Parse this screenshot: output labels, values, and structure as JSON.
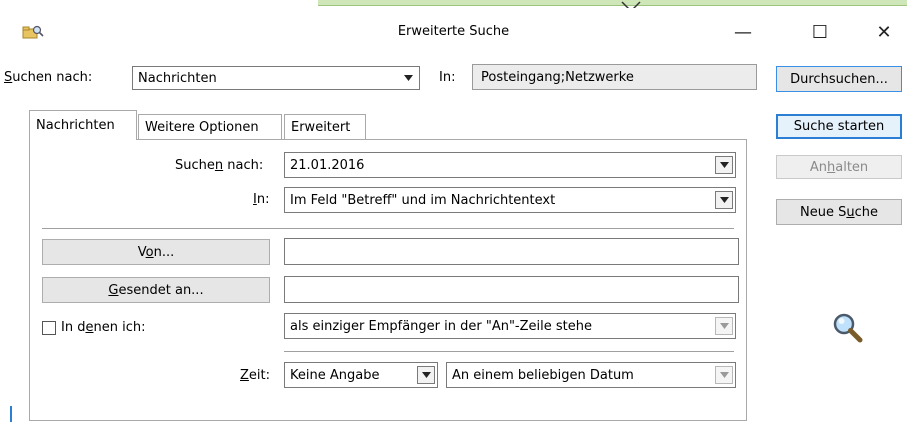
{
  "window": {
    "title": "Erweiterte Suche",
    "controls": {
      "minimize": "—",
      "maximize": "☐",
      "close": "✕"
    }
  },
  "search_row": {
    "look_for_label": "Suchen nach:",
    "look_for_value": "Nachrichten",
    "in_label": "In:",
    "in_value": "Posteingang;Netzwerke"
  },
  "buttons": {
    "browse": "Durchsuchen...",
    "find_now": "Suche starten",
    "stop": "Anhalten",
    "new_search": "Neue Suche"
  },
  "tabs": [
    {
      "label": "Nachrichten",
      "active": true
    },
    {
      "label": "Weitere Optionen",
      "active": false
    },
    {
      "label": "Erweitert",
      "active": false
    }
  ],
  "form": {
    "search_for_label": "Suchen nach:",
    "search_for_value": "21.01.2016",
    "in_label": "In:",
    "in_value": "Im Feld \"Betreff\" und im Nachrichtentext",
    "from_button": "Von...",
    "from_value": "",
    "sent_to_button": "Gesendet an...",
    "sent_to_value": "",
    "where_i_am_label": "In denen ich:",
    "where_i_am_value": "als einziger Empfänger in der \"An\"-Zeile stehe",
    "where_i_am_checked": false,
    "time_label": "Zeit:",
    "time_value": "Keine Angabe",
    "date_value": "An einem beliebigen Datum"
  },
  "icons": {
    "app": "search-folder-icon",
    "magnifier": "magnifier-icon"
  },
  "colors": {
    "accent_border": "#2a7fd4",
    "top_strip": "#cfe6b8"
  }
}
